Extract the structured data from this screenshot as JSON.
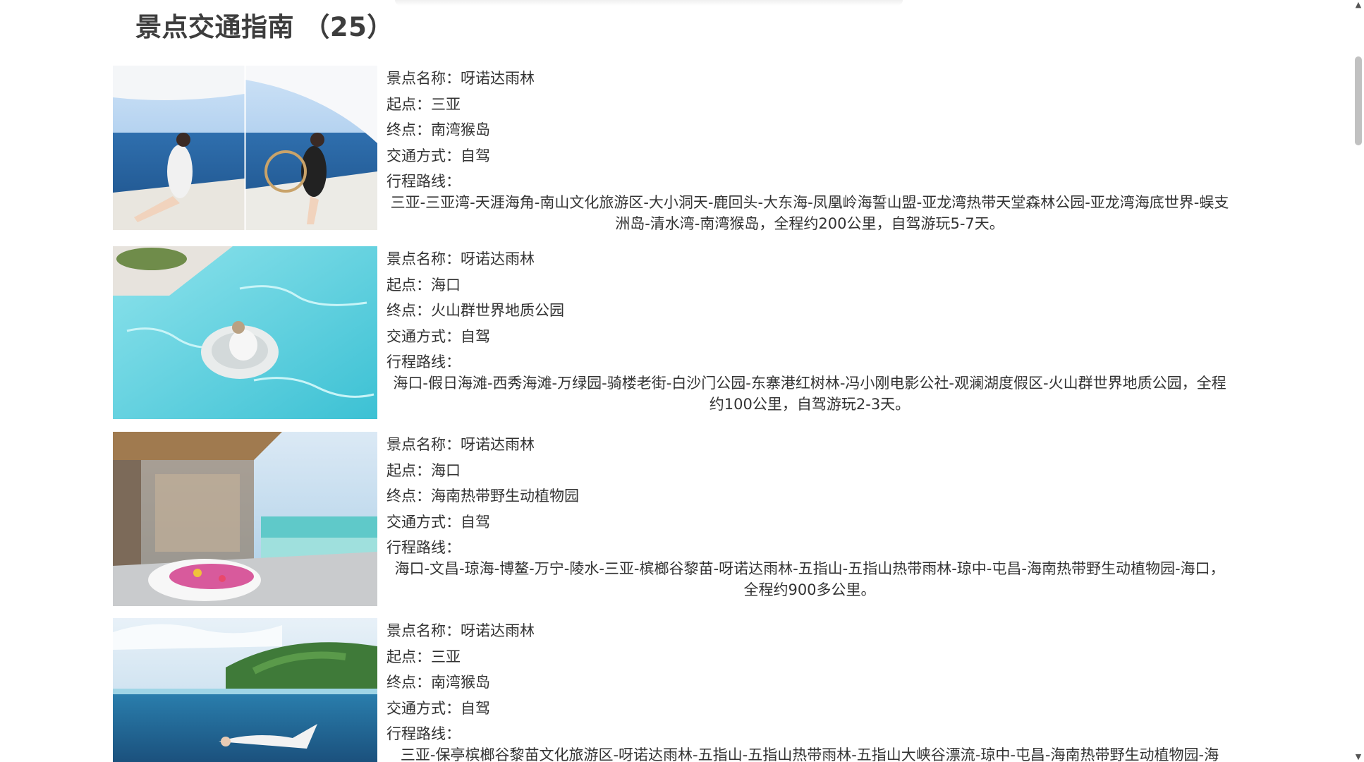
{
  "page": {
    "title": "景点交通指南 （25）"
  },
  "labels": {
    "name": "景点名称：",
    "start": "起点：",
    "end": "终点：",
    "transport": "交通方式：",
    "route": "行程路线："
  },
  "items": [
    {
      "image": "sailboat-photo",
      "name": "呀诺达雨林",
      "start": "三亚",
      "end": "南湾猴岛",
      "transport": "自驾",
      "route": "三亚-三亚湾-天涯海角-南山文化旅游区-大小洞天-鹿回头-大东海-凤凰岭海誓山盟-亚龙湾热带天堂森林公园-亚龙湾海底世界-蜈支洲岛-清水湾-南湾猴岛，全程约200公里，自驾游玩5-7天。"
    },
    {
      "image": "pool-photo",
      "name": "呀诺达雨林",
      "start": "海口",
      "end": "火山群世界地质公园",
      "transport": "自驾",
      "route": "海口-假日海滩-西秀海滩-万绿园-骑楼老街-白沙门公园-东寨港红树林-冯小刚电影公社-观澜湖度假区-火山群世界地质公园，全程约100公里，自驾游玩2-3天。"
    },
    {
      "image": "villa-bath-photo",
      "name": "呀诺达雨林",
      "start": "海口",
      "end": "海南热带野生动植物园",
      "transport": "自驾",
      "route": "海口-文昌-琼海-博鳌-万宁-陵水-三亚-槟榔谷黎苗-呀诺达雨林-五指山-五指山热带雨林-琼中-屯昌-海南热带野生动植物园-海口，全程约900多公里。"
    },
    {
      "image": "snorkel-photo",
      "name": "呀诺达雨林",
      "start": "三亚",
      "end": "南湾猴岛",
      "transport": "自驾",
      "route": "三亚-保亭槟榔谷黎苗文化旅游区-呀诺达雨林-五指山-五指山热带雨林-五指山大峡谷漂流-琼中-屯昌-海南热带野生动植物园-海"
    }
  ],
  "scrollbar": {
    "up_icon": "▲",
    "down_icon": "▼",
    "position_fraction": 0.1
  }
}
